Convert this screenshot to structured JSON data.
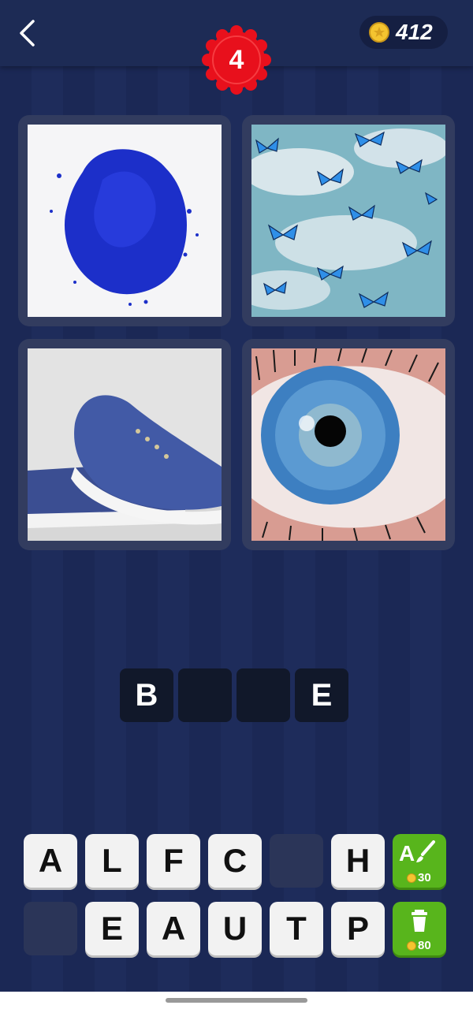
{
  "header": {
    "level": "4",
    "coins": "412"
  },
  "images": [
    {
      "subject": "blue pigment powder"
    },
    {
      "subject": "blue butterflies in sky"
    },
    {
      "subject": "blue canvas sneakers"
    },
    {
      "subject": "blue eye"
    }
  ],
  "answer_slots": [
    "B",
    "",
    "",
    "E"
  ],
  "keyboard": {
    "row1": [
      "A",
      "L",
      "F",
      "C",
      "",
      "H"
    ],
    "row2": [
      "",
      "E",
      "A",
      "U",
      "T",
      "P"
    ]
  },
  "powerups": {
    "reveal_letter": {
      "label": "A",
      "cost": "30",
      "icon": "paintbrush-icon"
    },
    "remove_letters": {
      "cost": "80",
      "icon": "trash-icon"
    }
  },
  "colors": {
    "background": "#1b2855",
    "level_badge": "#e8101c",
    "powerup": "#58b51c"
  }
}
